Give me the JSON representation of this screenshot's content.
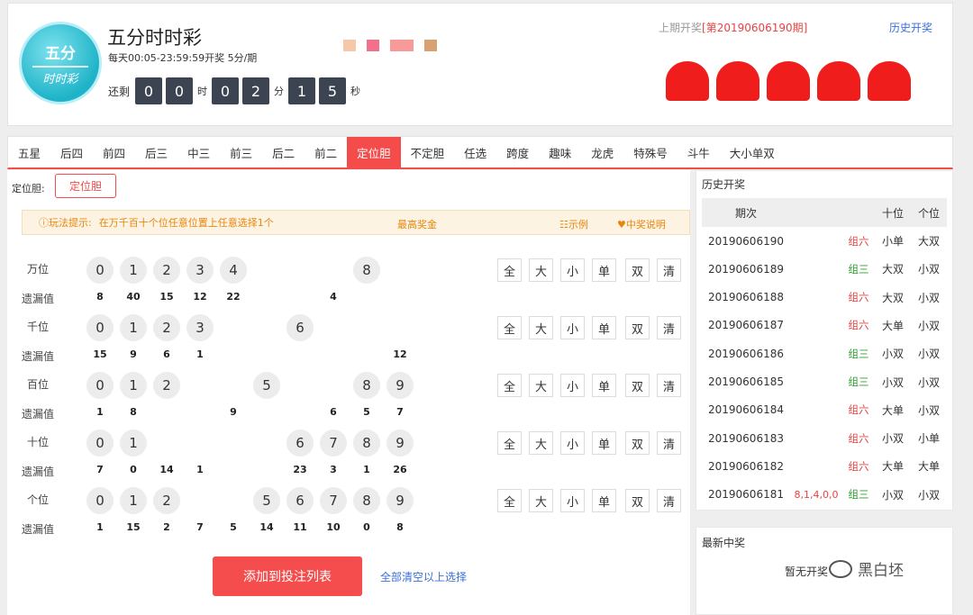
{
  "header": {
    "logo_line1": "五分",
    "logo_line2": "时时彩",
    "title": "五分时时彩",
    "schedule": "每天00:05-23:59:59开奖 5分/期",
    "countdown": {
      "prefix": "还剩",
      "hour_digits": [
        "0",
        "0"
      ],
      "hour_unit": "时",
      "minute_digits": [
        "0",
        "2"
      ],
      "minute_unit": "分",
      "second_digits": [
        "1",
        "5"
      ],
      "second_unit": "秒"
    },
    "prev_label": "上期开奖",
    "prev_issue": "[第20190606190期]",
    "history_link": "历史开奖",
    "chip_colors": [
      "#f6c8a8",
      "#f2708b",
      "#f89a99",
      "#d8a173"
    ],
    "ball_color": "#f01d1d"
  },
  "tabs": [
    "五星",
    "后四",
    "前四",
    "后三",
    "中三",
    "前三",
    "后二",
    "前二",
    "定位胆",
    "不定胆",
    "任选",
    "跨度",
    "趣味",
    "龙虎",
    "特殊号",
    "斗牛",
    "大小单双"
  ],
  "active_tab": "定位胆",
  "subplay": {
    "label": "定位胆:",
    "button": "定位胆"
  },
  "tip": {
    "icon": "ⓘ",
    "key": "玩法提示:",
    "text": "在万千百十个位任意位置上任意选择1个",
    "max_prize": "最高奖金",
    "example": "☷示例",
    "rules": "♥中奖说明"
  },
  "quick_buttons": [
    "全",
    "大",
    "小",
    "单",
    "双",
    "清"
  ],
  "miss_label": "遗漏值",
  "positions": [
    {
      "name": "万位",
      "numbers": [
        "0",
        "1",
        "2",
        "3",
        "4",
        "",
        "",
        "",
        "8",
        ""
      ],
      "misses": [
        "8",
        "40",
        "15",
        "12",
        "22",
        "",
        "",
        "4",
        "",
        ""
      ]
    },
    {
      "name": "千位",
      "numbers": [
        "0",
        "1",
        "2",
        "3",
        "",
        "",
        "6",
        "",
        "",
        ""
      ],
      "misses": [
        "15",
        "9",
        "6",
        "1",
        "",
        "",
        "",
        "",
        "",
        "12"
      ]
    },
    {
      "name": "百位",
      "numbers": [
        "0",
        "1",
        "2",
        "",
        "",
        "5",
        "",
        "",
        "8",
        "9"
      ],
      "misses": [
        "1",
        "8",
        "",
        "",
        "9",
        "",
        "",
        "6",
        "5",
        "7"
      ]
    },
    {
      "name": "十位",
      "numbers": [
        "0",
        "1",
        "",
        "",
        "",
        "",
        "6",
        "7",
        "8",
        "9"
      ],
      "misses": [
        "7",
        "0",
        "14",
        "1",
        "",
        "",
        "23",
        "3",
        "1",
        "26"
      ]
    },
    {
      "name": "个位",
      "numbers": [
        "0",
        "1",
        "2",
        "",
        "",
        "5",
        "6",
        "7",
        "8",
        "9"
      ],
      "misses": [
        "1",
        "15",
        "2",
        "7",
        "5",
        "14",
        "11",
        "10",
        "0",
        "8"
      ]
    }
  ],
  "actions": {
    "add": "添加到投注列表",
    "clear_all": "全部清空以上选择"
  },
  "history": {
    "title": "历史开奖",
    "headers": {
      "issue": "期次",
      "ten": "十位",
      "unit": "个位"
    },
    "rows": [
      {
        "issue": "20190606190",
        "nums": "",
        "form": "组六",
        "form_color": "red",
        "ten": "小单",
        "unit": "大双"
      },
      {
        "issue": "20190606189",
        "nums": "",
        "form": "组三",
        "form_color": "green",
        "ten": "大双",
        "unit": "小双"
      },
      {
        "issue": "20190606188",
        "nums": "",
        "form": "组六",
        "form_color": "red",
        "ten": "大双",
        "unit": "小双"
      },
      {
        "issue": "20190606187",
        "nums": "",
        "form": "组六",
        "form_color": "red",
        "ten": "大单",
        "unit": "小双"
      },
      {
        "issue": "20190606186",
        "nums": "",
        "form": "组三",
        "form_color": "green",
        "ten": "小双",
        "unit": "小双"
      },
      {
        "issue": "20190606185",
        "nums": "",
        "form": "组三",
        "form_color": "green",
        "ten": "小双",
        "unit": "小双"
      },
      {
        "issue": "20190606184",
        "nums": "",
        "form": "组六",
        "form_color": "red",
        "ten": "大单",
        "unit": "小双"
      },
      {
        "issue": "20190606183",
        "nums": "",
        "form": "组六",
        "form_color": "red",
        "ten": "小双",
        "unit": "小单"
      },
      {
        "issue": "20190606182",
        "nums": "",
        "form": "组六",
        "form_color": "red",
        "ten": "大单",
        "unit": "大单"
      },
      {
        "issue": "20190606181",
        "nums": "8,1,4,0,0",
        "form": "组三",
        "form_color": "green",
        "ten": "小双",
        "unit": "小双"
      }
    ]
  },
  "latest": {
    "title": "最新中奖",
    "empty": "暂无开奖"
  },
  "watermark": "黑白坯"
}
